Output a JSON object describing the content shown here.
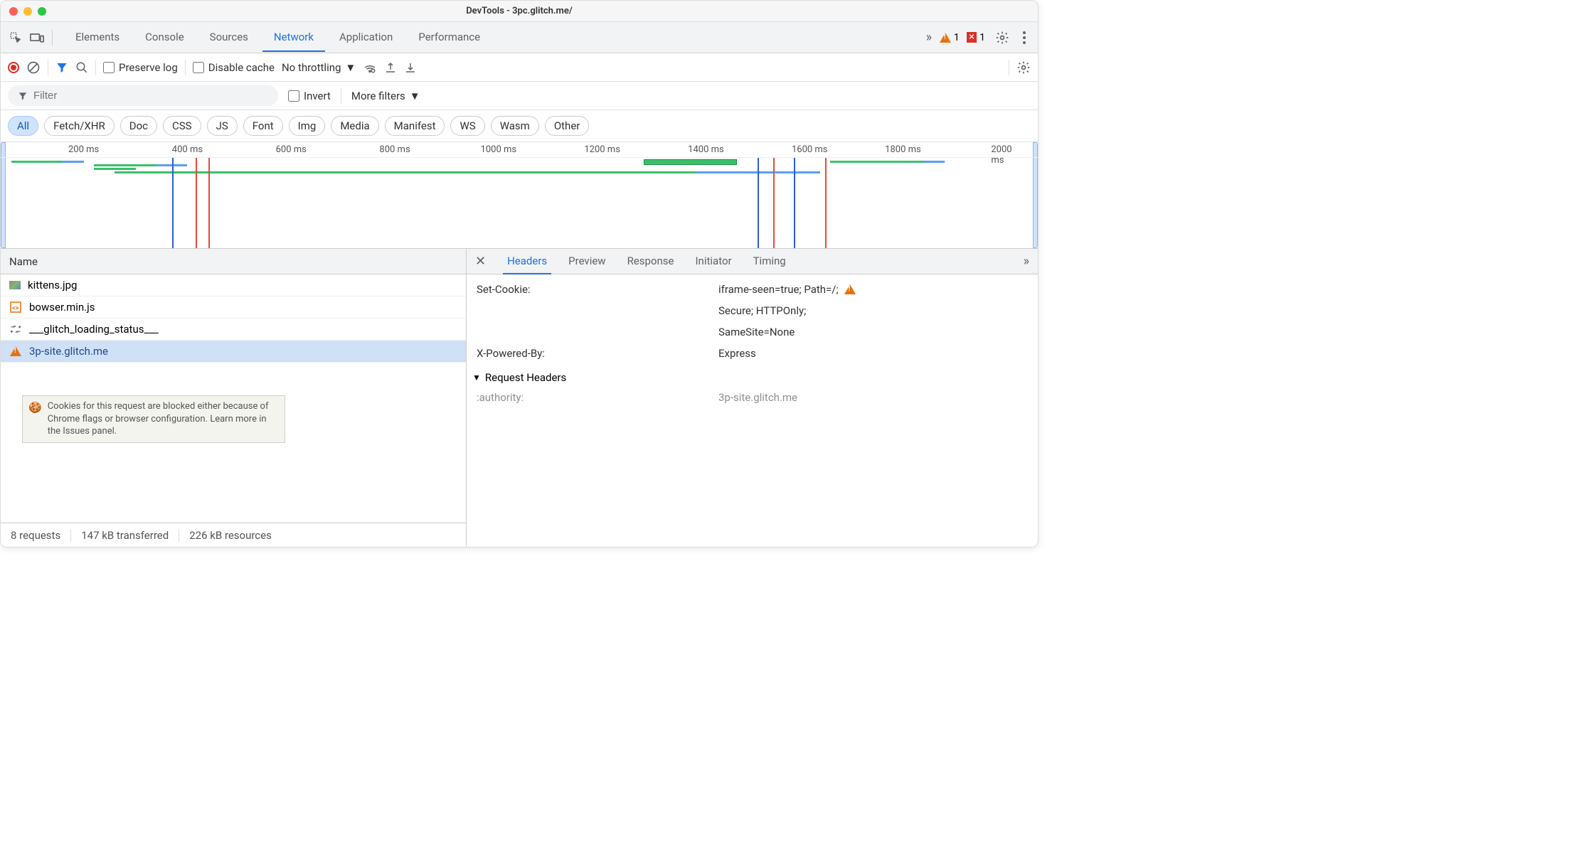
{
  "window": {
    "title": "DevTools - 3pc.glitch.me/"
  },
  "tabs": {
    "items": [
      "Elements",
      "Console",
      "Sources",
      "Network",
      "Application",
      "Performance"
    ],
    "active": "Network"
  },
  "badges": {
    "warnings": "1",
    "errors": "1"
  },
  "toolbar": {
    "preserve_log": "Preserve log",
    "disable_cache": "Disable cache",
    "throttling": "No throttling"
  },
  "filterbar": {
    "placeholder": "Filter",
    "invert": "Invert",
    "more_filters": "More filters"
  },
  "type_filters": [
    "All",
    "Fetch/XHR",
    "Doc",
    "CSS",
    "JS",
    "Font",
    "Img",
    "Media",
    "Manifest",
    "WS",
    "Wasm",
    "Other"
  ],
  "type_filters_active": "All",
  "timeline": {
    "ticks": [
      "200 ms",
      "400 ms",
      "600 ms",
      "800 ms",
      "1000 ms",
      "1200 ms",
      "1400 ms",
      "1600 ms",
      "1800 ms",
      "2000 ms"
    ]
  },
  "left": {
    "header": "Name",
    "rows": [
      {
        "icon": "image",
        "name": "kittens.jpg"
      },
      {
        "icon": "js",
        "name": "bowser.min.js"
      },
      {
        "icon": "xhr",
        "name": "___glitch_loading_status___"
      },
      {
        "icon": "warn",
        "name": "3p-site.glitch.me",
        "selected": true
      }
    ],
    "tooltip": "Cookies for this request are blocked either because of Chrome flags or browser configuration. Learn more in the Issues panel.",
    "status": {
      "requests": "8 requests",
      "transferred": "147 kB transferred",
      "resources": "226 kB resources"
    }
  },
  "right": {
    "tabs": [
      "Headers",
      "Preview",
      "Response",
      "Initiator",
      "Timing"
    ],
    "active": "Headers",
    "headers": [
      {
        "name": "Set-Cookie:",
        "values": [
          "iframe-seen=true; Path=/;",
          "Secure; HTTPOnly;",
          "SameSite=None"
        ],
        "warn": true
      },
      {
        "name": "X-Powered-By:",
        "values": [
          "Express"
        ]
      }
    ],
    "request_section": "Request Headers",
    "request_rows": [
      {
        "name": ":authority:",
        "value": "3p-site.glitch.me"
      }
    ]
  }
}
